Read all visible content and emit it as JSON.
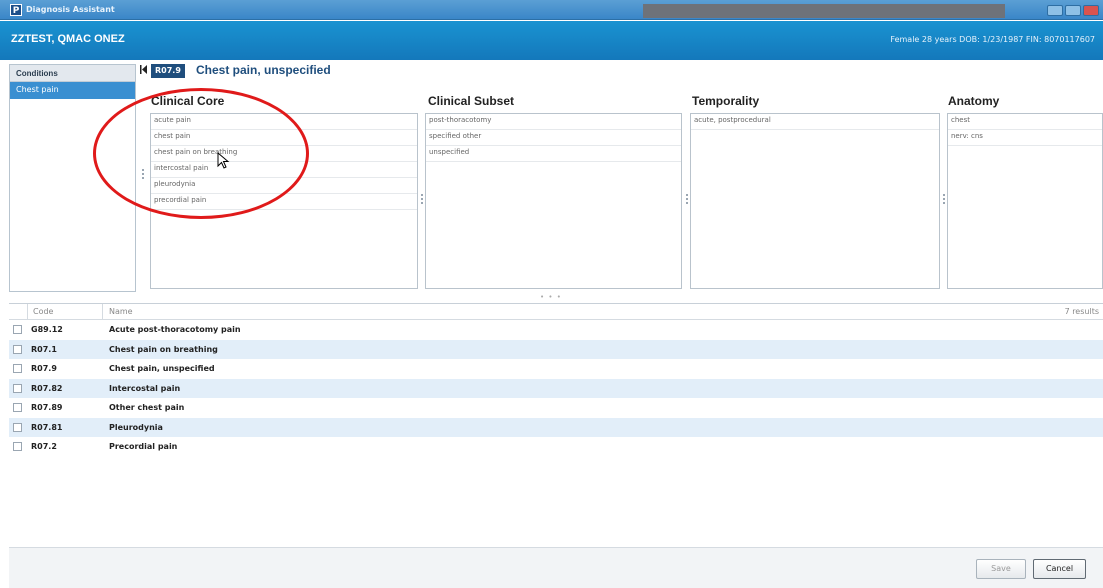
{
  "window": {
    "app_icon": "P",
    "title": "Diagnosis Assistant"
  },
  "patient": {
    "name": "ZZTEST, QMAC ONEZ",
    "info": "Female  28 years  DOB: 1/23/1987  FIN: 8070117607"
  },
  "sidebar": {
    "header": "Conditions",
    "items": [
      {
        "label": "Chest pain",
        "selected": true
      }
    ]
  },
  "diagnosis": {
    "code": "R07.9",
    "title": "Chest pain, unspecified"
  },
  "columns": [
    {
      "heading": "Clinical Core",
      "items": [
        "acute pain",
        "chest pain",
        "chest pain on breathing",
        "intercostal pain",
        "pleurodynia",
        "precordial pain"
      ]
    },
    {
      "heading": "Clinical Subset",
      "items": [
        "post-thoracotomy",
        "specified other",
        "unspecified"
      ]
    },
    {
      "heading": "Temporality",
      "items": [
        "acute, postprocedural"
      ]
    },
    {
      "heading": "Anatomy",
      "items": [
        "chest",
        "nerv: cns"
      ]
    }
  ],
  "splitter_dots": "• • •",
  "results": {
    "headers": {
      "code": "Code",
      "name": "Name"
    },
    "count_label": "7 results",
    "rows": [
      {
        "code": "G89.12",
        "name": "Acute post-thoracotomy pain"
      },
      {
        "code": "R07.1",
        "name": "Chest pain on breathing"
      },
      {
        "code": "R07.9",
        "name": "Chest pain, unspecified"
      },
      {
        "code": "R07.82",
        "name": "Intercostal pain"
      },
      {
        "code": "R07.89",
        "name": "Other chest pain"
      },
      {
        "code": "R07.81",
        "name": "Pleurodynia"
      },
      {
        "code": "R07.2",
        "name": "Precordial pain"
      }
    ]
  },
  "footer": {
    "save_label": "Save",
    "cancel_label": "Cancel"
  },
  "colors": {
    "header": "#1a93d1",
    "selected": "#3a8fd1",
    "alt_row": "#e2eef9",
    "annotation": "#e01a1a"
  },
  "icons": {
    "collapse": "collapse-left-icon",
    "cursor": "mouse-pointer-icon"
  }
}
